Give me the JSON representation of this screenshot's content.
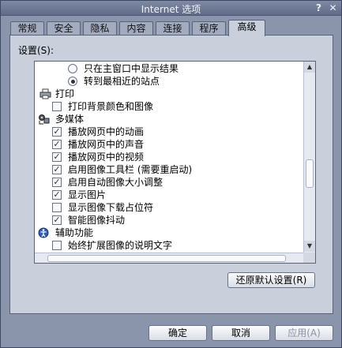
{
  "window": {
    "title": "Internet 选项",
    "help_glyph": "?",
    "close_glyph": "✕"
  },
  "tabs": [
    {
      "label": "常规",
      "active": false
    },
    {
      "label": "安全",
      "active": false
    },
    {
      "label": "隐私",
      "active": false
    },
    {
      "label": "内容",
      "active": false
    },
    {
      "label": "连接",
      "active": false
    },
    {
      "label": "程序",
      "active": false
    },
    {
      "label": "高级",
      "active": true
    }
  ],
  "settings": {
    "label": "设置(S):",
    "items": [
      {
        "kind": "radio",
        "checked": false,
        "label": "只在主窗口中显示结果"
      },
      {
        "kind": "radio",
        "checked": true,
        "label": "转到最相近的站点"
      },
      {
        "kind": "category",
        "icon": "printer-icon",
        "label": "打印"
      },
      {
        "kind": "checkbox",
        "checked": false,
        "label": "打印背景颜色和图像"
      },
      {
        "kind": "category",
        "icon": "multimedia-icon",
        "label": "多媒体"
      },
      {
        "kind": "checkbox",
        "checked": true,
        "label": "播放网页中的动画"
      },
      {
        "kind": "checkbox",
        "checked": true,
        "label": "播放网页中的声音"
      },
      {
        "kind": "checkbox",
        "checked": true,
        "label": "播放网页中的视频"
      },
      {
        "kind": "checkbox",
        "checked": true,
        "label": "启用图像工具栏 (需要重启动)"
      },
      {
        "kind": "checkbox",
        "checked": true,
        "label": "启用自动图像大小调整"
      },
      {
        "kind": "checkbox",
        "checked": true,
        "label": "显示图片"
      },
      {
        "kind": "checkbox",
        "checked": false,
        "label": "显示图像下载占位符"
      },
      {
        "kind": "checkbox",
        "checked": true,
        "label": "智能图像抖动"
      },
      {
        "kind": "category",
        "icon": "accessibility-icon",
        "label": "辅助功能"
      },
      {
        "kind": "checkbox",
        "checked": false,
        "label": "始终扩展图像的说明文字"
      }
    ],
    "check_glyph": "✓"
  },
  "buttons": {
    "restore": "还原默认设置(R)",
    "ok": "确定",
    "cancel": "取消",
    "apply": "应用(A)"
  },
  "scroll_glyphs": {
    "up": "▲",
    "down": "▼"
  }
}
